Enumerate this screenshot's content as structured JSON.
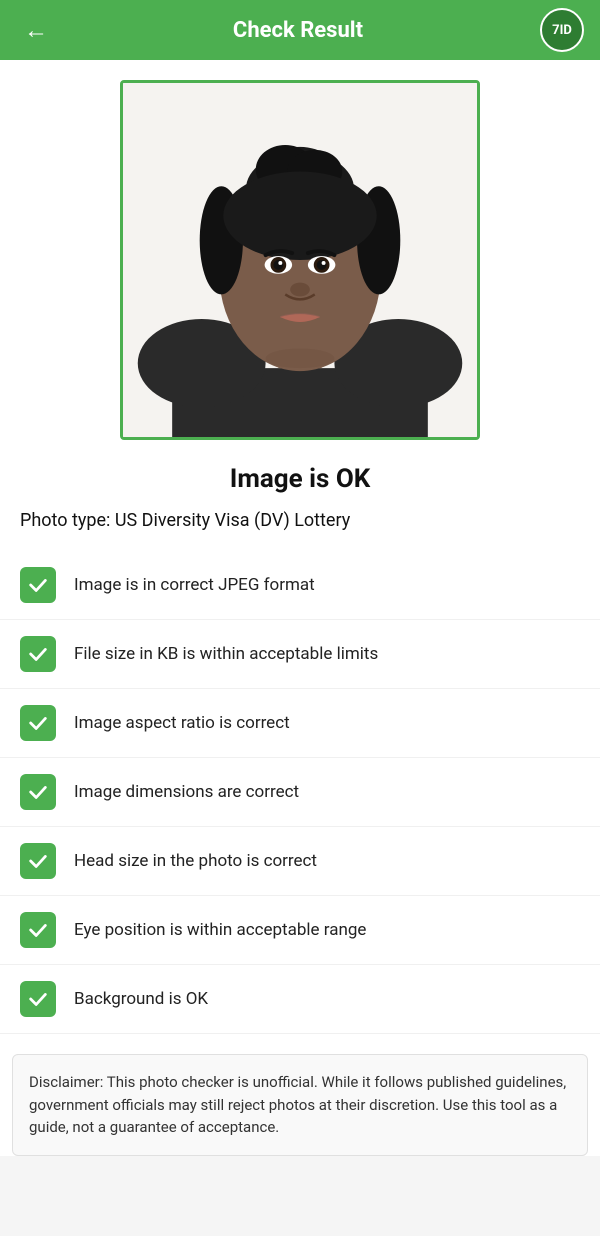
{
  "header": {
    "title": "Check Result",
    "back_label": "←",
    "logo_text": "7ID"
  },
  "status": {
    "label": "Image is OK"
  },
  "photo_type": {
    "label": "Photo type: US Diversity Visa (DV) Lottery"
  },
  "checks": [
    {
      "id": "jpeg-format",
      "label": "Image is in correct JPEG format",
      "passed": true
    },
    {
      "id": "file-size",
      "label": "File size in KB is within acceptable limits",
      "passed": true
    },
    {
      "id": "aspect-ratio",
      "label": "Image aspect ratio is correct",
      "passed": true
    },
    {
      "id": "dimensions",
      "label": "Image dimensions are correct",
      "passed": true
    },
    {
      "id": "head-size",
      "label": "Head size in the photo is correct",
      "passed": true
    },
    {
      "id": "eye-position",
      "label": "Eye position is within acceptable range",
      "passed": true
    },
    {
      "id": "background",
      "label": "Background is OK",
      "passed": true
    }
  ],
  "disclaimer": {
    "text": "Disclaimer: This photo checker is unofficial. While it follows published guidelines, government officials may still reject photos at their discretion. Use this tool as a guide, not a guarantee of acceptance."
  }
}
